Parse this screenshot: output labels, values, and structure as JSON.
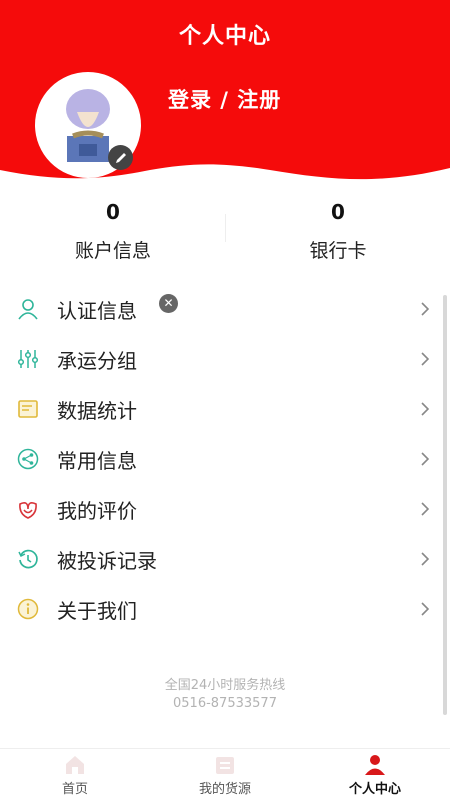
{
  "header": {
    "title": "个人中心",
    "login_label": "登录 / 注册"
  },
  "stats": [
    {
      "value": "0",
      "label": "账户信息"
    },
    {
      "value": "0",
      "label": "银行卡"
    }
  ],
  "menu": [
    {
      "label": "认证信息",
      "icon": "person-icon",
      "has_clear_badge": true
    },
    {
      "label": "承运分组",
      "icon": "sliders-icon"
    },
    {
      "label": "数据统计",
      "icon": "note-icon"
    },
    {
      "label": "常用信息",
      "icon": "share-icon"
    },
    {
      "label": "我的评价",
      "icon": "flower-icon"
    },
    {
      "label": "被投诉记录",
      "icon": "history-icon"
    },
    {
      "label": "关于我们",
      "icon": "info-icon"
    }
  ],
  "footer": {
    "hotline_label": "全国24小时服务热线",
    "hotline_number": "0516-87533577"
  },
  "tabs": [
    {
      "label": "首页",
      "icon": "home-icon",
      "active": false
    },
    {
      "label": "我的货源",
      "icon": "cargo-icon",
      "active": false
    },
    {
      "label": "个人中心",
      "icon": "person-icon",
      "active": true
    }
  ],
  "colors": {
    "brand_red": "#f50b0b",
    "icon_teal": "#2fb59a",
    "icon_yellow": "#e0b93a",
    "icon_red": "#d8353a"
  }
}
